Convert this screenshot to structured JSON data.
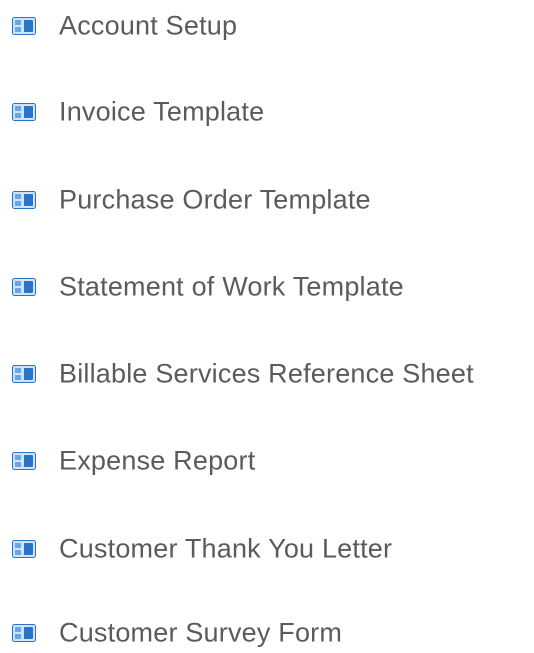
{
  "document_list": {
    "items": [
      {
        "label": "Account Setup",
        "icon": "document-icon"
      },
      {
        "label": "Invoice Template",
        "icon": "document-icon"
      },
      {
        "label": "Purchase Order Template",
        "icon": "document-icon"
      },
      {
        "label": "Statement of Work Template",
        "icon": "document-icon"
      },
      {
        "label": "Billable Services Reference Sheet",
        "icon": "document-icon"
      },
      {
        "label": "Expense Report",
        "icon": "document-icon"
      },
      {
        "label": "Customer Thank You Letter",
        "icon": "document-icon"
      },
      {
        "label": "Customer Survey Form",
        "icon": "document-icon"
      }
    ]
  },
  "colors": {
    "text": "#5b5b5b",
    "icon_light": "#cfe4fb",
    "icon_dark": "#2b74c5",
    "icon_mid": "#6aa6e4"
  }
}
